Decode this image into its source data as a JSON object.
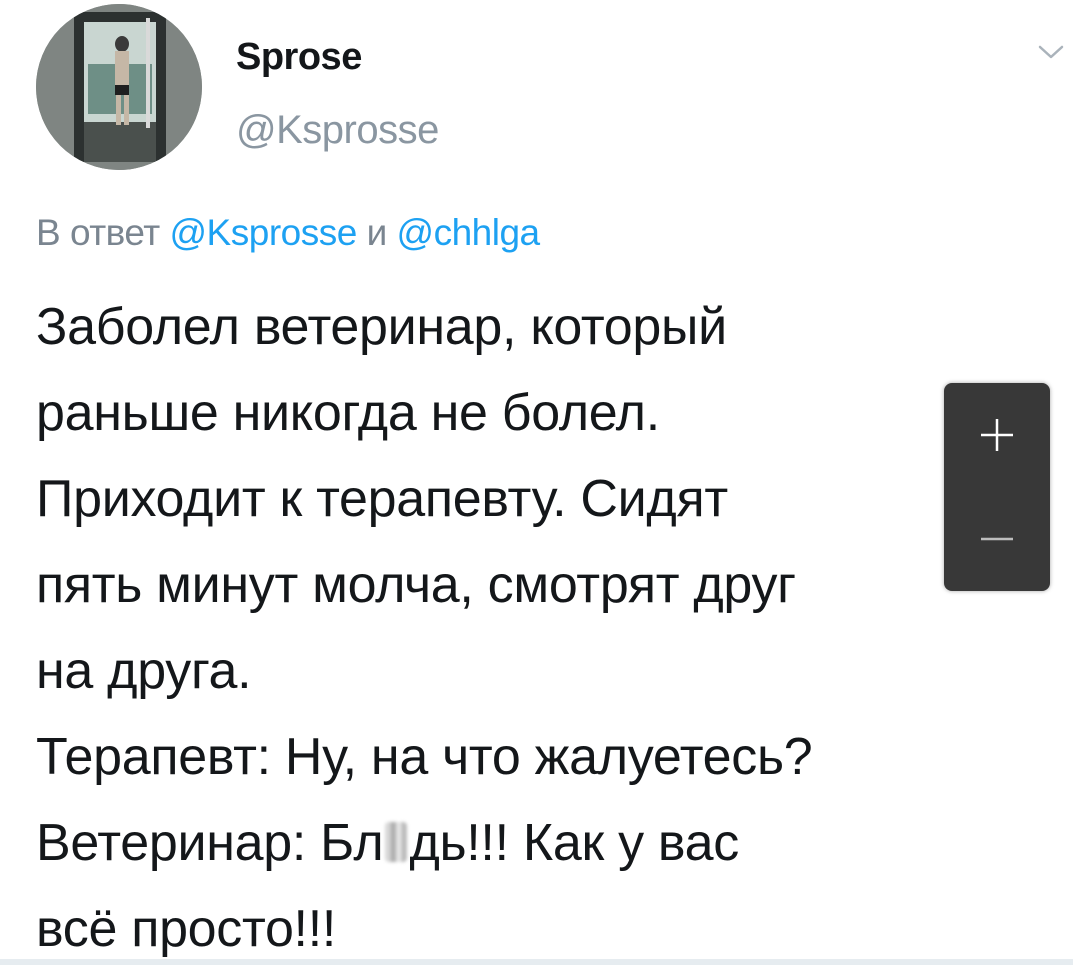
{
  "author": {
    "display_name": "Sprose",
    "handle": "@Ksprosse"
  },
  "reply": {
    "prefix": "В ответ",
    "mention_1": "@Ksprosse",
    "conjunction": "и",
    "mention_2": "@chhlga"
  },
  "tweet": {
    "lines": [
      "Заболел ветеринар, который",
      "раньше никогда не болел.",
      "Приходит к терапевту. Сидят",
      "пять минут молча, смотрят друг",
      "на друга.",
      "Терапевт: Ну, на что жалуетесь?"
    ],
    "line7_before_censor": "Ветеринар: Бл",
    "line7_after_censor": "дь!!! Как у вас",
    "line8": "всё просто!!!"
  },
  "zoom": {
    "zoom_in_icon": "plus-icon",
    "zoom_out_icon": "minus-icon"
  },
  "colors": {
    "text": "#14171a",
    "muted": "#8a96a1",
    "link": "#1da1f2",
    "zoom_bg": "#383838"
  }
}
